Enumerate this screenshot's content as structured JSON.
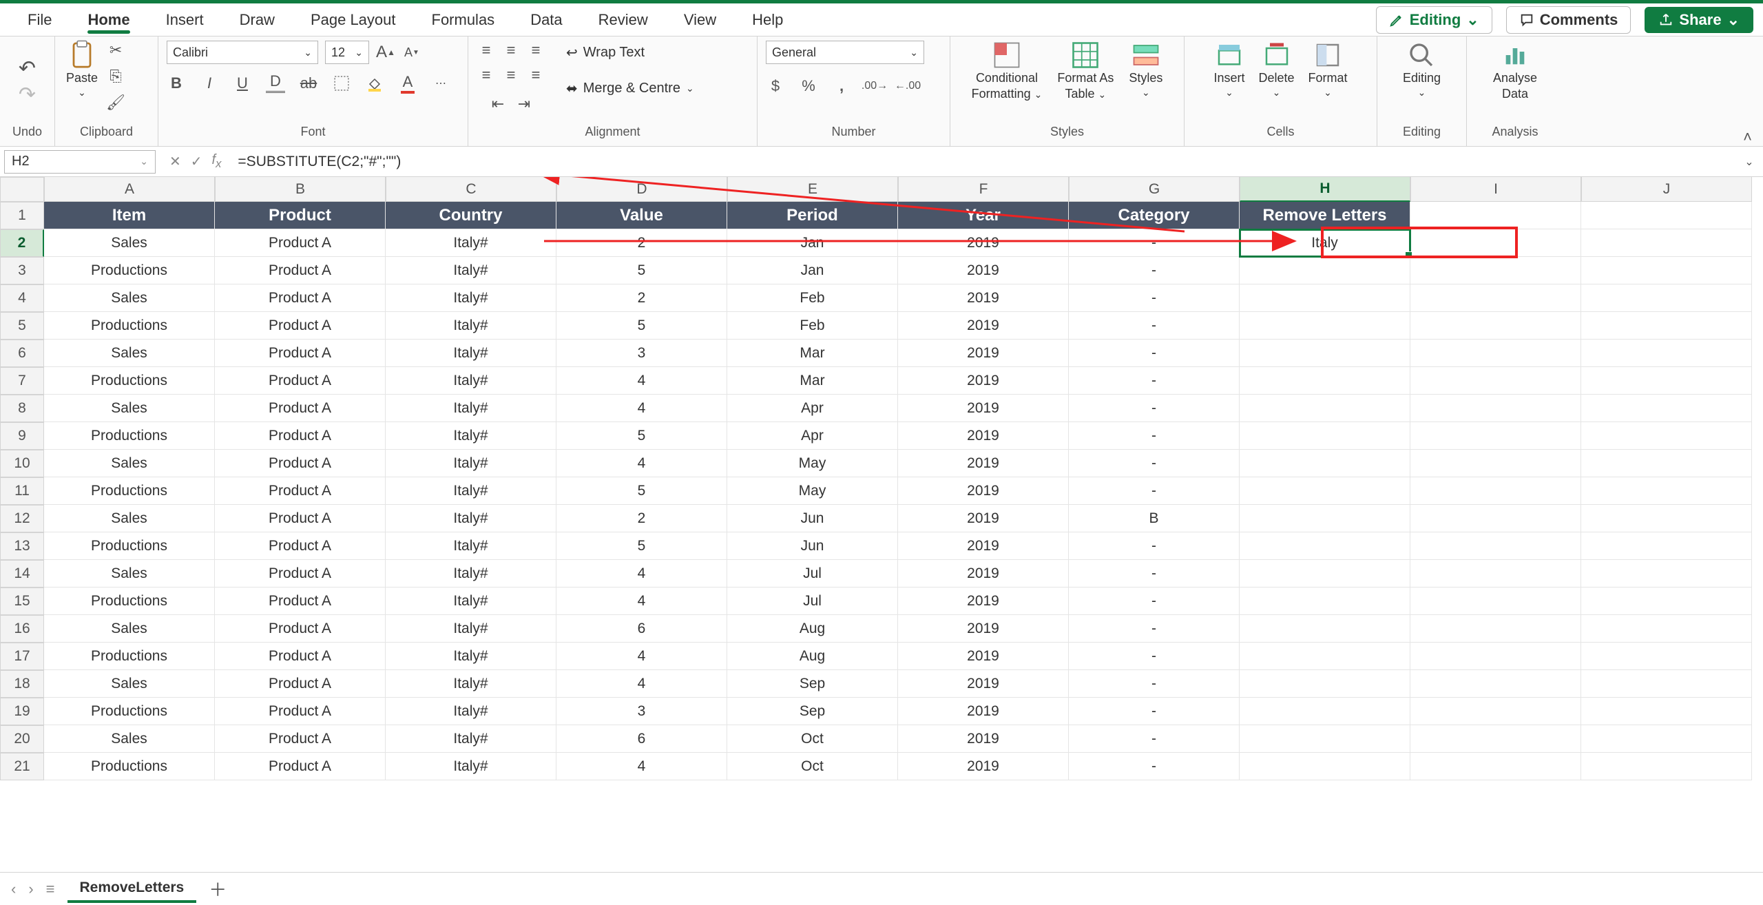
{
  "menu": {
    "tabs": [
      "File",
      "Home",
      "Insert",
      "Draw",
      "Page Layout",
      "Formulas",
      "Data",
      "Review",
      "View",
      "Help"
    ],
    "active_index": 1,
    "editing_label": "Editing",
    "comments_label": "Comments",
    "share_label": "Share"
  },
  "ribbon": {
    "undo_label": "Undo",
    "clipboard_label": "Clipboard",
    "paste_label": "Paste",
    "font_label": "Font",
    "font_name": "Calibri",
    "font_size": "12",
    "alignment_label": "Alignment",
    "wrap_text": "Wrap Text",
    "merge_center": "Merge & Centre",
    "number_label": "Number",
    "number_format": "General",
    "styles_label": "Styles",
    "conditional_formatting": "Conditional",
    "conditional_formatting2": "Formatting",
    "format_as_table": "Format As",
    "format_as_table2": "Table",
    "styles_btn": "Styles",
    "cells_label": "Cells",
    "insert_btn": "Insert",
    "delete_btn": "Delete",
    "format_btn": "Format",
    "editing_label": "Editing",
    "editing_btn": "Editing",
    "analysis_label": "Analysis",
    "analyse_btn": "Analyse",
    "analyse_btn2": "Data"
  },
  "formula_bar": {
    "name_box": "H2",
    "formula": "=SUBSTITUTE(C2;\"#\";\"\")"
  },
  "grid": {
    "columns": [
      "A",
      "B",
      "C",
      "D",
      "E",
      "F",
      "G",
      "H",
      "I",
      "J"
    ],
    "selected_col_index": 7,
    "selected_row_index": 1,
    "headers": [
      "Item",
      "Product",
      "Country",
      "Value",
      "Period",
      "Year",
      "Category",
      "Remove Letters"
    ],
    "rows": [
      {
        "n": "1"
      },
      {
        "n": "2",
        "cells": [
          "Sales",
          "Product A",
          "Italy#",
          "2",
          "Jan",
          "2019",
          "-",
          "Italy"
        ]
      },
      {
        "n": "3",
        "cells": [
          "Productions",
          "Product A",
          "Italy#",
          "5",
          "Jan",
          "2019",
          "-",
          ""
        ]
      },
      {
        "n": "4",
        "cells": [
          "Sales",
          "Product A",
          "Italy#",
          "2",
          "Feb",
          "2019",
          "-",
          ""
        ]
      },
      {
        "n": "5",
        "cells": [
          "Productions",
          "Product A",
          "Italy#",
          "5",
          "Feb",
          "2019",
          "-",
          ""
        ]
      },
      {
        "n": "6",
        "cells": [
          "Sales",
          "Product A",
          "Italy#",
          "3",
          "Mar",
          "2019",
          "-",
          ""
        ]
      },
      {
        "n": "7",
        "cells": [
          "Productions",
          "Product A",
          "Italy#",
          "4",
          "Mar",
          "2019",
          "-",
          ""
        ]
      },
      {
        "n": "8",
        "cells": [
          "Sales",
          "Product A",
          "Italy#",
          "4",
          "Apr",
          "2019",
          "-",
          ""
        ]
      },
      {
        "n": "9",
        "cells": [
          "Productions",
          "Product A",
          "Italy#",
          "5",
          "Apr",
          "2019",
          "-",
          ""
        ]
      },
      {
        "n": "10",
        "cells": [
          "Sales",
          "Product A",
          "Italy#",
          "4",
          "May",
          "2019",
          "-",
          ""
        ]
      },
      {
        "n": "11",
        "cells": [
          "Productions",
          "Product A",
          "Italy#",
          "5",
          "May",
          "2019",
          "-",
          ""
        ]
      },
      {
        "n": "12",
        "cells": [
          "Sales",
          "Product A",
          "Italy#",
          "2",
          "Jun",
          "2019",
          "B",
          ""
        ]
      },
      {
        "n": "13",
        "cells": [
          "Productions",
          "Product A",
          "Italy#",
          "5",
          "Jun",
          "2019",
          "-",
          ""
        ]
      },
      {
        "n": "14",
        "cells": [
          "Sales",
          "Product A",
          "Italy#",
          "4",
          "Jul",
          "2019",
          "-",
          ""
        ]
      },
      {
        "n": "15",
        "cells": [
          "Productions",
          "Product A",
          "Italy#",
          "4",
          "Jul",
          "2019",
          "-",
          ""
        ]
      },
      {
        "n": "16",
        "cells": [
          "Sales",
          "Product A",
          "Italy#",
          "6",
          "Aug",
          "2019",
          "-",
          ""
        ]
      },
      {
        "n": "17",
        "cells": [
          "Productions",
          "Product A",
          "Italy#",
          "4",
          "Aug",
          "2019",
          "-",
          ""
        ]
      },
      {
        "n": "18",
        "cells": [
          "Sales",
          "Product A",
          "Italy#",
          "4",
          "Sep",
          "2019",
          "-",
          ""
        ]
      },
      {
        "n": "19",
        "cells": [
          "Productions",
          "Product A",
          "Italy#",
          "3",
          "Sep",
          "2019",
          "-",
          ""
        ]
      },
      {
        "n": "20",
        "cells": [
          "Sales",
          "Product A",
          "Italy#",
          "6",
          "Oct",
          "2019",
          "-",
          ""
        ]
      },
      {
        "n": "21",
        "cells": [
          "Productions",
          "Product A",
          "Italy#",
          "4",
          "Oct",
          "2019",
          "-",
          ""
        ]
      }
    ]
  },
  "sheet_bar": {
    "active_sheet": "RemoveLetters"
  }
}
